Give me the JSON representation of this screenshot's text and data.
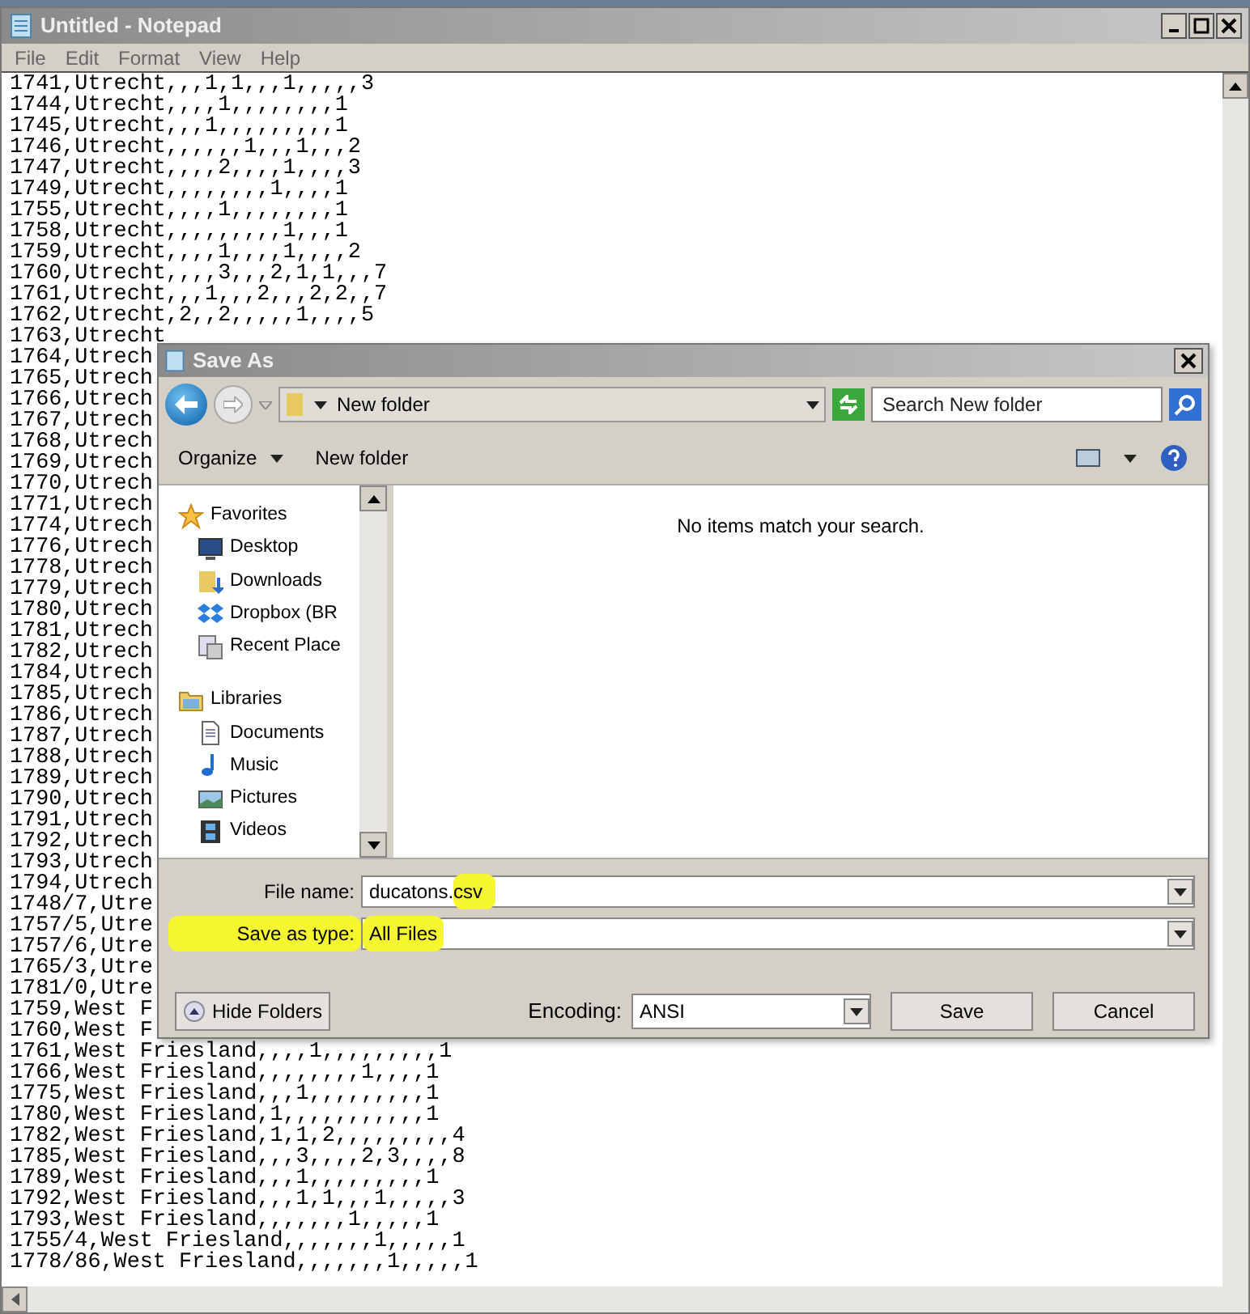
{
  "notepad": {
    "title": "Untitled - Notepad",
    "menu": [
      "File",
      "Edit",
      "Format",
      "View",
      "Help"
    ],
    "lines": [
      "1741,Utrecht,,,1,1,,,1,,,,,3",
      "1744,Utrecht,,,,1,,,,,,,,1",
      "1745,Utrecht,,,1,,,,,,,,,1",
      "1746,Utrecht,,,,,,1,,,1,,,2",
      "1747,Utrecht,,,,2,,,,1,,,,3",
      "1749,Utrecht,,,,,,,,1,,,,1",
      "1755,Utrecht,,,,1,,,,,,,,1",
      "1758,Utrecht,,,,,,,,,1,,,1",
      "1759,Utrecht,,,,1,,,,1,,,,2",
      "1760,Utrecht,,,,3,,,2,1,1,,,7",
      "1761,Utrecht,,,1,,,2,,,2,2,,7",
      "1762,Utrecht,2,,2,,,,,1,,,,5",
      "1763,Utrecht",
      "1764,Utrech",
      "1765,Utrech",
      "1766,Utrech",
      "1767,Utrech",
      "1768,Utrech",
      "1769,Utrech",
      "1770,Utrech",
      "1771,Utrech",
      "1774,Utrech",
      "1776,Utrech",
      "1778,Utrech",
      "1779,Utrech",
      "1780,Utrech",
      "1781,Utrech",
      "1782,Utrech",
      "1784,Utrech",
      "1785,Utrech",
      "1786,Utrech",
      "1787,Utrech",
      "1788,Utrech",
      "1789,Utrech",
      "1790,Utrech",
      "1791,Utrech",
      "1792,Utrech",
      "1793,Utrech",
      "1794,Utrech",
      "1748/7,Utre",
      "1757/5,Utre",
      "1757/6,Utre",
      "1765/3,Utre",
      "1781/0,Utre",
      "1759,West F",
      "1760,West F",
      "1761,West Friesland,,,,1,,,,,,,,,1",
      "1766,West Friesland,,,,,,,,1,,,,1",
      "1775,West Friesland,,,1,,,,,,,,,1",
      "1780,West Friesland,1,,,,,,,,,,,1",
      "1782,West Friesland,1,1,2,,,,,,,,,4",
      "1785,West Friesland,,,3,,,,2,3,,,,8",
      "1789,West Friesland,,,1,,,,,,,,,1",
      "1792,West Friesland,,,1,1,,,1,,,,,3",
      "1793,West Friesland,,,,,,,1,,,,,1",
      "1755/4,West Friesland,,,,,,,1,,,,,1",
      "1778/86,West Friesland,,,,,,,1,,,,,1"
    ]
  },
  "dialog": {
    "title": "Save As",
    "path": "New folder",
    "search": {
      "placeholder": "Search New folder"
    },
    "toolbar": [
      "Organize",
      "New folder"
    ],
    "nav": [
      {
        "label": "Favorites",
        "kind": "star",
        "children": [
          {
            "label": "Desktop",
            "kind": "desktop"
          },
          {
            "label": "Downloads",
            "kind": "downloads"
          },
          {
            "label": "Dropbox (BR",
            "kind": "dropbox"
          },
          {
            "label": "Recent Place",
            "kind": "recent"
          }
        ]
      },
      {
        "label": "Libraries",
        "kind": "library",
        "children": [
          {
            "label": "Documents",
            "kind": "documents"
          },
          {
            "label": "Music",
            "kind": "music"
          },
          {
            "label": "Pictures",
            "kind": "pictures"
          },
          {
            "label": "Videos",
            "kind": "videos"
          }
        ]
      }
    ],
    "empty_message": "No items match your search.",
    "file_name": {
      "label": "File name:",
      "value": "ducatons.csv",
      "highlighted": true
    },
    "save_type": {
      "label": "Save as type:",
      "value": "All Files",
      "highlighted": true
    },
    "hide_folders": "Hide Folders",
    "encoding": {
      "label": "Encoding:",
      "value": "ANSI"
    },
    "buttons": [
      "Save",
      "Cancel"
    ]
  }
}
